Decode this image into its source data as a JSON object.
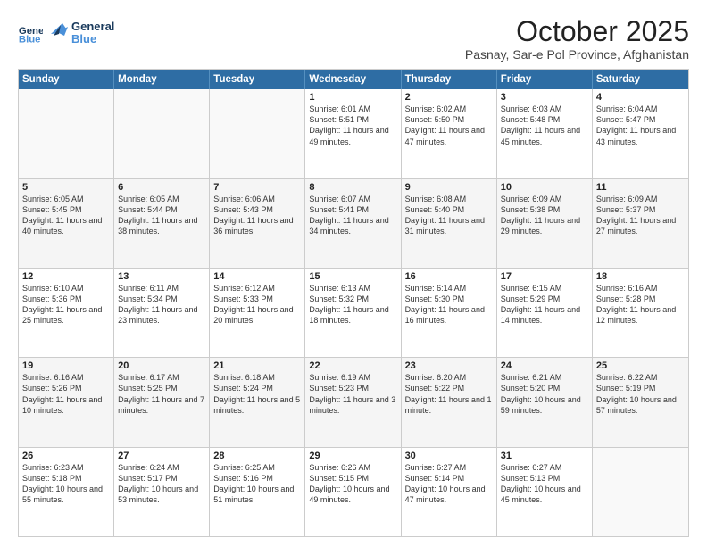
{
  "logo": {
    "line1": "General",
    "line2": "Blue"
  },
  "title": "October 2025",
  "subtitle": "Pasnay, Sar-e Pol Province, Afghanistan",
  "header_days": [
    "Sunday",
    "Monday",
    "Tuesday",
    "Wednesday",
    "Thursday",
    "Friday",
    "Saturday"
  ],
  "rows": [
    [
      {
        "day": "",
        "text": ""
      },
      {
        "day": "",
        "text": ""
      },
      {
        "day": "",
        "text": ""
      },
      {
        "day": "1",
        "text": "Sunrise: 6:01 AM\nSunset: 5:51 PM\nDaylight: 11 hours and 49 minutes."
      },
      {
        "day": "2",
        "text": "Sunrise: 6:02 AM\nSunset: 5:50 PM\nDaylight: 11 hours and 47 minutes."
      },
      {
        "day": "3",
        "text": "Sunrise: 6:03 AM\nSunset: 5:48 PM\nDaylight: 11 hours and 45 minutes."
      },
      {
        "day": "4",
        "text": "Sunrise: 6:04 AM\nSunset: 5:47 PM\nDaylight: 11 hours and 43 minutes."
      }
    ],
    [
      {
        "day": "5",
        "text": "Sunrise: 6:05 AM\nSunset: 5:45 PM\nDaylight: 11 hours and 40 minutes."
      },
      {
        "day": "6",
        "text": "Sunrise: 6:05 AM\nSunset: 5:44 PM\nDaylight: 11 hours and 38 minutes."
      },
      {
        "day": "7",
        "text": "Sunrise: 6:06 AM\nSunset: 5:43 PM\nDaylight: 11 hours and 36 minutes."
      },
      {
        "day": "8",
        "text": "Sunrise: 6:07 AM\nSunset: 5:41 PM\nDaylight: 11 hours and 34 minutes."
      },
      {
        "day": "9",
        "text": "Sunrise: 6:08 AM\nSunset: 5:40 PM\nDaylight: 11 hours and 31 minutes."
      },
      {
        "day": "10",
        "text": "Sunrise: 6:09 AM\nSunset: 5:38 PM\nDaylight: 11 hours and 29 minutes."
      },
      {
        "day": "11",
        "text": "Sunrise: 6:09 AM\nSunset: 5:37 PM\nDaylight: 11 hours and 27 minutes."
      }
    ],
    [
      {
        "day": "12",
        "text": "Sunrise: 6:10 AM\nSunset: 5:36 PM\nDaylight: 11 hours and 25 minutes."
      },
      {
        "day": "13",
        "text": "Sunrise: 6:11 AM\nSunset: 5:34 PM\nDaylight: 11 hours and 23 minutes."
      },
      {
        "day": "14",
        "text": "Sunrise: 6:12 AM\nSunset: 5:33 PM\nDaylight: 11 hours and 20 minutes."
      },
      {
        "day": "15",
        "text": "Sunrise: 6:13 AM\nSunset: 5:32 PM\nDaylight: 11 hours and 18 minutes."
      },
      {
        "day": "16",
        "text": "Sunrise: 6:14 AM\nSunset: 5:30 PM\nDaylight: 11 hours and 16 minutes."
      },
      {
        "day": "17",
        "text": "Sunrise: 6:15 AM\nSunset: 5:29 PM\nDaylight: 11 hours and 14 minutes."
      },
      {
        "day": "18",
        "text": "Sunrise: 6:16 AM\nSunset: 5:28 PM\nDaylight: 11 hours and 12 minutes."
      }
    ],
    [
      {
        "day": "19",
        "text": "Sunrise: 6:16 AM\nSunset: 5:26 PM\nDaylight: 11 hours and 10 minutes."
      },
      {
        "day": "20",
        "text": "Sunrise: 6:17 AM\nSunset: 5:25 PM\nDaylight: 11 hours and 7 minutes."
      },
      {
        "day": "21",
        "text": "Sunrise: 6:18 AM\nSunset: 5:24 PM\nDaylight: 11 hours and 5 minutes."
      },
      {
        "day": "22",
        "text": "Sunrise: 6:19 AM\nSunset: 5:23 PM\nDaylight: 11 hours and 3 minutes."
      },
      {
        "day": "23",
        "text": "Sunrise: 6:20 AM\nSunset: 5:22 PM\nDaylight: 11 hours and 1 minute."
      },
      {
        "day": "24",
        "text": "Sunrise: 6:21 AM\nSunset: 5:20 PM\nDaylight: 10 hours and 59 minutes."
      },
      {
        "day": "25",
        "text": "Sunrise: 6:22 AM\nSunset: 5:19 PM\nDaylight: 10 hours and 57 minutes."
      }
    ],
    [
      {
        "day": "26",
        "text": "Sunrise: 6:23 AM\nSunset: 5:18 PM\nDaylight: 10 hours and 55 minutes."
      },
      {
        "day": "27",
        "text": "Sunrise: 6:24 AM\nSunset: 5:17 PM\nDaylight: 10 hours and 53 minutes."
      },
      {
        "day": "28",
        "text": "Sunrise: 6:25 AM\nSunset: 5:16 PM\nDaylight: 10 hours and 51 minutes."
      },
      {
        "day": "29",
        "text": "Sunrise: 6:26 AM\nSunset: 5:15 PM\nDaylight: 10 hours and 49 minutes."
      },
      {
        "day": "30",
        "text": "Sunrise: 6:27 AM\nSunset: 5:14 PM\nDaylight: 10 hours and 47 minutes."
      },
      {
        "day": "31",
        "text": "Sunrise: 6:27 AM\nSunset: 5:13 PM\nDaylight: 10 hours and 45 minutes."
      },
      {
        "day": "",
        "text": ""
      }
    ]
  ]
}
